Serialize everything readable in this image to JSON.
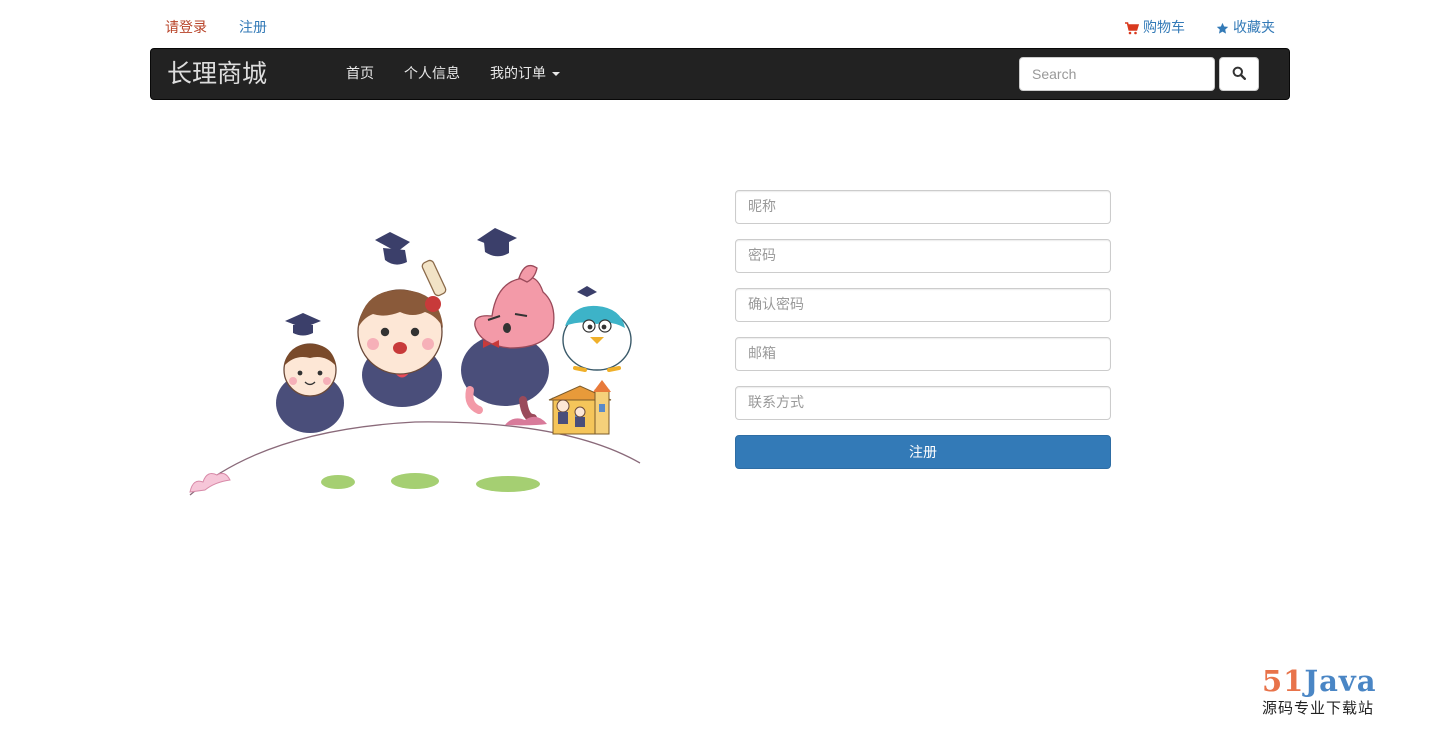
{
  "topbar": {
    "login_label": "请登录",
    "register_label": "注册",
    "cart_label": "购物车",
    "favorites_label": "收藏夹"
  },
  "navbar": {
    "brand": "长理商城",
    "items": [
      {
        "label": "首页"
      },
      {
        "label": "个人信息"
      },
      {
        "label": "我的订单"
      }
    ],
    "search_placeholder": "Search"
  },
  "form": {
    "nickname_placeholder": "昵称",
    "password_placeholder": "密码",
    "confirm_password_placeholder": "确认密码",
    "email_placeholder": "邮箱",
    "contact_placeholder": "联系方式",
    "submit_label": "注册"
  },
  "watermark": {
    "logo_num": "51",
    "logo_text": "Java",
    "subtitle": "源码专业下载站"
  },
  "colors": {
    "navbar_bg": "#222222",
    "primary": "#337ab7",
    "login_link": "#b8442a",
    "cart_icon": "#d9391e"
  },
  "icons": {
    "cart": "shopping-cart-icon",
    "favorites": "star-icon",
    "search": "search-icon",
    "dropdown": "caret-down-icon"
  }
}
